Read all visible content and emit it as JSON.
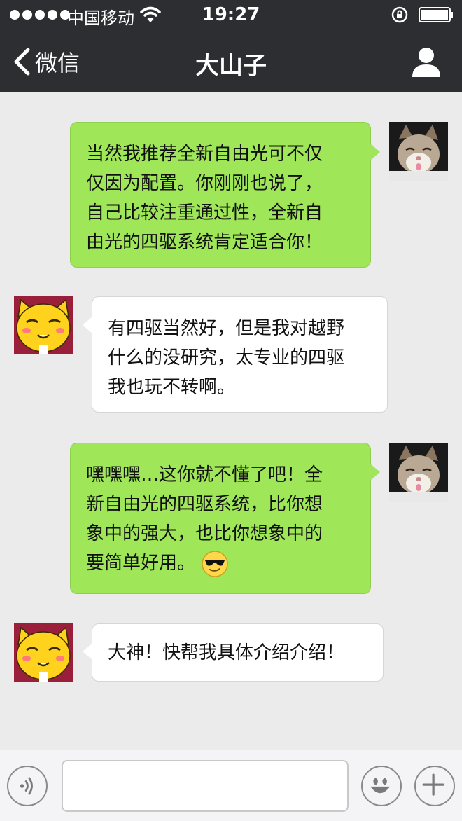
{
  "status_bar": {
    "carrier": "中国移动",
    "time": "19:27",
    "signal_icon": "signal-dots-icon",
    "wifi_icon": "wifi-icon",
    "lock_icon": "rotation-lock-icon",
    "battery_icon": "battery-icon"
  },
  "nav": {
    "back_label": "微信",
    "title": "大山子",
    "back_icon": "chevron-left-icon",
    "profile_icon": "person-icon"
  },
  "colors": {
    "nav_bg": "#2d2e32",
    "outgoing_bubble": "#9fe658",
    "incoming_bubble": "#ffffff",
    "chat_bg": "#ebebeb"
  },
  "messages": [
    {
      "direction": "out",
      "avatar": "cat-photo-avatar",
      "lines": [
        "当然我推荐全新自由光可不仅",
        "仅因为配置。你刚刚也说了，",
        "自己比较注重通过性，全新自",
        "由光的四驱系统肯定适合你！"
      ]
    },
    {
      "direction": "in",
      "avatar": "cartoon-cat-avatar",
      "lines": [
        "有四驱当然好，但是我对越野",
        "什么的没研究，太专业的四驱",
        "我也玩不转啊。"
      ]
    },
    {
      "direction": "out",
      "avatar": "cat-photo-avatar",
      "lines": [
        "嘿嘿嘿…这你就不懂了吧！全",
        "新自由光的四驱系统，比你想",
        "象中的强大，也比你想象中的",
        "要简单好用。"
      ],
      "emoji": "sunglasses-smiley-icon"
    },
    {
      "direction": "in",
      "avatar": "cartoon-cat-avatar",
      "lines": [
        "大神！快帮我具体介绍介绍！"
      ]
    }
  ],
  "input_bar": {
    "voice_icon": "voice-icon",
    "input_value": "",
    "emoji_icon": "emoji-icon",
    "plus_icon": "plus-icon"
  }
}
